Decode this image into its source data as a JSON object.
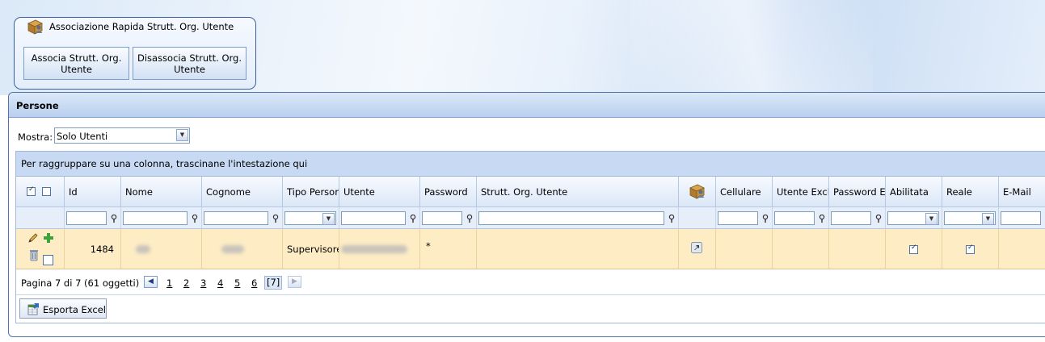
{
  "quick_panel": {
    "title": "Associazione Rapida Strutt. Org. Utente",
    "icon": "box-user-icon",
    "associa_label": "Associa Strutt. Org. Utente",
    "disassocia_label": "Disassocia Strutt. Org. Utente"
  },
  "persone": {
    "title": "Persone",
    "mostra_label": "Mostra:",
    "mostra_value": "Solo Utenti",
    "group_hint": "Per raggruppare su una colonna, trascinane l'intestazione qui",
    "columns": {
      "id": "Id",
      "nome": "Nome",
      "cognome": "Cognome",
      "tipo_persona": "Tipo Persor",
      "utente": "Utente",
      "password": "Password",
      "strutt_org_utente": "Strutt. Org. Utente",
      "cellulare": "Cellulare",
      "utente_excl": "Utente Excl",
      "password_e": "Password E",
      "abilitata": "Abilitata",
      "reale": "Reale",
      "email": "E-Mail"
    },
    "row": {
      "id": "1484",
      "tipo_persona": "Supervisore",
      "password": "*",
      "abilitata": true,
      "reale": true
    },
    "pager": {
      "info": "Pagina 7 di 7 (61 oggetti)",
      "pages": [
        "1",
        "2",
        "3",
        "4",
        "5",
        "6"
      ],
      "current": "[7]"
    },
    "export_label": "Esporta Excel"
  }
}
